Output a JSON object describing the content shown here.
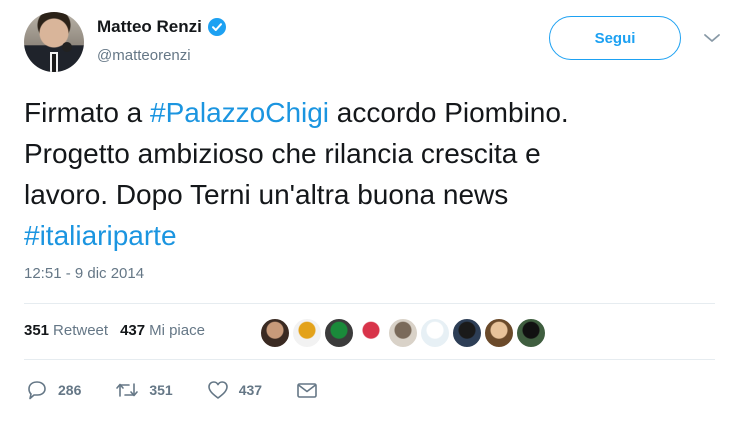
{
  "author": {
    "display_name": "Matteo Renzi",
    "handle": "@matteorenzi",
    "verified": true
  },
  "follow_button": {
    "label": "Segui"
  },
  "tweet": {
    "text_lines": [
      {
        "parts": [
          {
            "text": "Firmato a ",
            "type": "text"
          },
          {
            "text": "#PalazzoChigi",
            "type": "hashtag"
          },
          {
            "text": " accordo Piombino.",
            "type": "text"
          }
        ]
      },
      {
        "parts": [
          {
            "text": "Progetto ambizioso che rilancia crescita e",
            "type": "text"
          }
        ]
      },
      {
        "parts": [
          {
            "text": "lavoro. Dopo Terni un'altra buona news",
            "type": "text"
          }
        ]
      },
      {
        "parts": [
          {
            "text": "#italiariparte",
            "type": "hashtag"
          }
        ]
      }
    ],
    "timestamp": "12:51 - 9 dic 2014"
  },
  "stats": {
    "retweets_count": "351",
    "retweets_label": "Retweet",
    "likes_count": "437",
    "likes_label": "Mi piace"
  },
  "likers": [
    {
      "name": "liker-1",
      "colors": [
        "#3a2a22",
        "#c89a7a"
      ]
    },
    {
      "name": "liker-2",
      "colors": [
        "#f2f2f2",
        "#e3a21a"
      ]
    },
    {
      "name": "liker-3",
      "colors": [
        "#3b3b3b",
        "#1a8a3a"
      ]
    },
    {
      "name": "liker-4",
      "colors": [
        "#ffffff",
        "#d8344a"
      ]
    },
    {
      "name": "liker-5",
      "colors": [
        "#d9d2c8",
        "#7a6a5a"
      ]
    },
    {
      "name": "liker-6",
      "colors": [
        "#e7f0f5",
        "#ffffff"
      ]
    },
    {
      "name": "liker-7",
      "colors": [
        "#2d3e56",
        "#1a1a1a"
      ]
    },
    {
      "name": "liker-8",
      "colors": [
        "#6b4a2a",
        "#e8c39a"
      ]
    },
    {
      "name": "liker-9",
      "colors": [
        "#3f5e3f",
        "#111111"
      ]
    }
  ],
  "actions": {
    "reply_count": "286",
    "retweet_count": "351",
    "like_count": "437"
  },
  "colors": {
    "accent": "#1da1f2",
    "hashtag": "#1b95e0",
    "secondary_text": "#657786",
    "icon": "#657786"
  },
  "icons": {
    "verified": "verified-badge-icon",
    "chevron": "chevron-down-icon",
    "reply": "reply-icon",
    "retweet": "retweet-icon",
    "like": "heart-icon",
    "dm": "envelope-icon"
  }
}
